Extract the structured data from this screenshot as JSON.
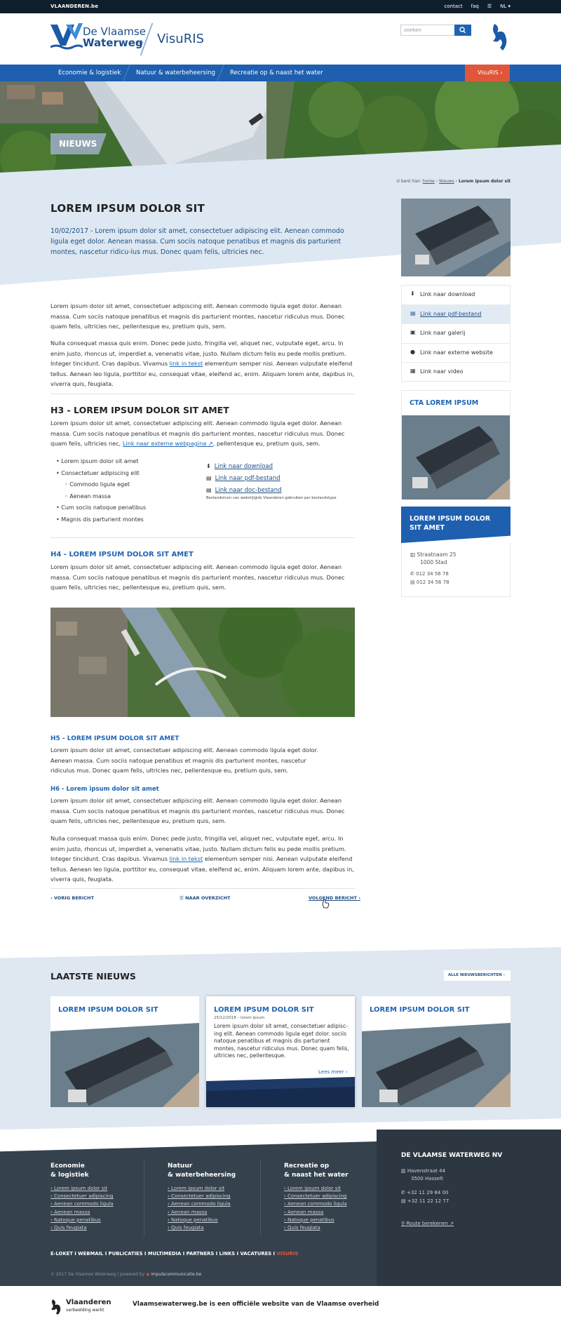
{
  "topbar": {
    "brand": "VLAANDEREN.be",
    "links": [
      "contact",
      "faq"
    ],
    "lang": "NL"
  },
  "header": {
    "logo_line1": "De Vlaamse",
    "logo_line2": "Waterweg",
    "logo_nv": "nv",
    "product": "VisuRIS",
    "search_placeholder": "zoeken"
  },
  "nav": {
    "items": [
      "Economie & logistiek",
      "Natuur & waterbeheersing",
      "Recreatie op & naast het water"
    ],
    "cta": "VisuRIS"
  },
  "hero": {
    "label": "NIEUWS"
  },
  "breadcrumb": {
    "prefix": "U bent hier:",
    "home": "home",
    "news": "Nieuws",
    "current": "Lorem ipsum dolor sit"
  },
  "article": {
    "title": "LOREM IPSUM DOLOR SIT",
    "lead": "10/02/2017 - Lorem ipsum dolor sit amet, consectetuer adipiscing elit. Aenean commodo ligula eget dolor. Aenean massa. Cum sociis natoque penatibus et magnis dis parturient montes, nascetur ridicu-lus mus. Donec quam felis, ultricies nec.",
    "p1": "Lorem ipsum dolor sit amet, consectetuer adipiscing elit. Aenean commodo ligula eget dolor. Aenean massa. Cum sociis natoque penatibus et magnis dis parturient montes, nascetur ridiculus mus. Donec quam felis, ultricies nec, pellentesque eu, pretium quis, sem.",
    "p2a": "Nulla consequat massa quis enim. Donec pede justo, fringilla vel, aliquet nec, vulputate eget, arcu. In enim justo, rhoncus ut, imperdiet a, venenatis vitae, justo. Nullam dictum felis eu pede mollis pretium. Integer tincidunt. Cras dapibus. Vivamus",
    "p2link": "link in tekst",
    "p2b": "elementum semper nisi. Aenean vulputate eleifend tellus. Aenean leo ligula, porttitor eu, consequat vitae, eleifend ac, enim. Aliquam lorem ante, dapibus in, viverra quis, feugiata.",
    "h3": "H3 - LOREM IPSUM DOLOR SIT AMET",
    "h3p": "Lorem ipsum dolor sit amet, consectetuer adipiscing elit. Aenean commodo ligula eget dolor. Aenean massa. Cum sociis natoque penatibus et magnis dis parturient montes, nascetur ridiculus mus. Donec quam felis, ultricies nec,",
    "h3link": "Link naar externe webpagina",
    "h3p_end": ", pellentesque eu, pretium quis, sem.",
    "bullets": [
      "Lorem ipsum dolor sit amet",
      "Consectetuer adipiscing elit"
    ],
    "subbullets": [
      "Commodo ligula eget",
      "Aenean massa"
    ],
    "bullets2": [
      "Cum sociis natoque penatibus",
      "Magnis dis parturient montes"
    ],
    "downloads": [
      "Link naar download",
      "Link naar pdf-bestand",
      "Link naar doc-bestand"
    ],
    "dl_note": "Bestandsiicon van webstijlgids Vlaanderen gebruiken per bestandstype",
    "h4": "H4 - LOREM IPSUM DOLOR SIT AMET",
    "h4p": "Lorem ipsum dolor sit amet, consectetuer adipiscing elit. Aenean commodo ligula eget dolor. Aenean massa. Cum sociis natoque penatibus et magnis dis parturient montes, nascetur ridiculus mus. Donec quam felis, ultricies nec, pellentesque eu, pretium quis, sem.",
    "h5": "H5 - LOREM IPSUM DOLOR SIT AMET",
    "h5p": "Lorem ipsum dolor sit amet, consectetuer adipiscing elit. Aenean commodo ligula eget dolor. Aenean massa. Cum sociis natoque penatibus et magnis dis parturient montes, nascetur ridiculus mus. Donec quam felis, ultricies nec, pellentesque eu, pretium quis, sem.",
    "h6": "H6 - Lorem ipsum dolor sit amet",
    "h6p": "Lorem ipsum dolor sit amet, consectetuer adipiscing elit. Aenean commodo ligula eget dolor. Aenean massa. Cum sociis natoque penatibus et magnis dis parturient montes, nascetur ridiculus mus. Donec quam felis, ultricies nec, pellentesque eu, pretium quis, sem.",
    "prev": "VORIG BERICHT",
    "overview": "NAAR OVERZICHT",
    "next": "VOLGEND BERICHT"
  },
  "sidebar": {
    "links": [
      "Link naar download",
      "Link naar pdf-bestand",
      "Link naar galerij",
      "Link naar externe website",
      "Link naar video"
    ],
    "cta": "CTA LOREM IPSUM",
    "contact_title": "LOREM IPSUM DOLOR SIT AMET",
    "street": "Straatnaam 25",
    "city": "1000 Stad",
    "phone": "012 34 56 78",
    "fax": "012 34 56 78"
  },
  "latest": {
    "title": "LAATSTE NIEUWS",
    "all": "ALLE NIEUWSBERICHTEN",
    "cards": [
      {
        "title": "LOREM IPSUM DOLOR SIT"
      },
      {
        "title": "LOREM IPSUM DOLOR SIT",
        "meta": "25/12/2018 – lorem ipsum",
        "text": "Lorem ipsum dolor sit amet, consectetuer adipisc-ing elit. Aenean commodo ligula eget dolor. sociis natoque penatibus et magnis dis parturient montes, nascetur ridiculus mus. Donec quam felis, ultricies nec, pellentesque.",
        "more": "Lees meer"
      },
      {
        "title": "LOREM IPSUM DOLOR SIT"
      }
    ]
  },
  "footer": {
    "cols": [
      {
        "h1": "Economie",
        "h2": "& logistiek",
        "links": [
          "Lorem ipsum dolor sit",
          "Consectetuer adipiscing",
          "Aenean commodo ligula",
          "Aenean massa",
          "Natoque penatibus",
          "Quis feugiata"
        ]
      },
      {
        "h1": "Natuur",
        "h2": "& waterbeheersing",
        "links": [
          "Lorem ipsum dolor sit",
          "Consectetuer adipiscing",
          "Aenean commodo ligula",
          "Aenean massa",
          "Natoque penatibus",
          "Quis feugiata"
        ]
      },
      {
        "h1": "Recreatie op",
        "h2": "& naast het water",
        "links": [
          "Lorem ipsum dolor sit",
          "Consectetuer adipiscing",
          "Aenean commodo ligula",
          "Aenean massa",
          "Natoque penatibus",
          "Quis feugiata"
        ]
      }
    ],
    "org": "DE VLAAMSE WATERWEG NV",
    "street": "Havenstraat 44",
    "city": "3500 Hasselt",
    "phone": "+32 11 29 84 00",
    "fax": "+32 11 22 12 77",
    "route": "Route berekenen",
    "bar": "E-LOKET I WEBMAIL I PUBLICATIES I MULTIMEDIA I PARTNERS I LINKS I VACATURES I",
    "bar_visuris": "VISURIS",
    "copy": "© 2017 De Vlaamse Waterweg | powered by",
    "powered": "impulscommunicatie.be"
  },
  "bottom": {
    "vl1": "Vlaanderen",
    "vl2": "verbeelding werkt",
    "text": "Vlaamsewaterweg.be is een officiële website van de Vlaamse overheid"
  }
}
